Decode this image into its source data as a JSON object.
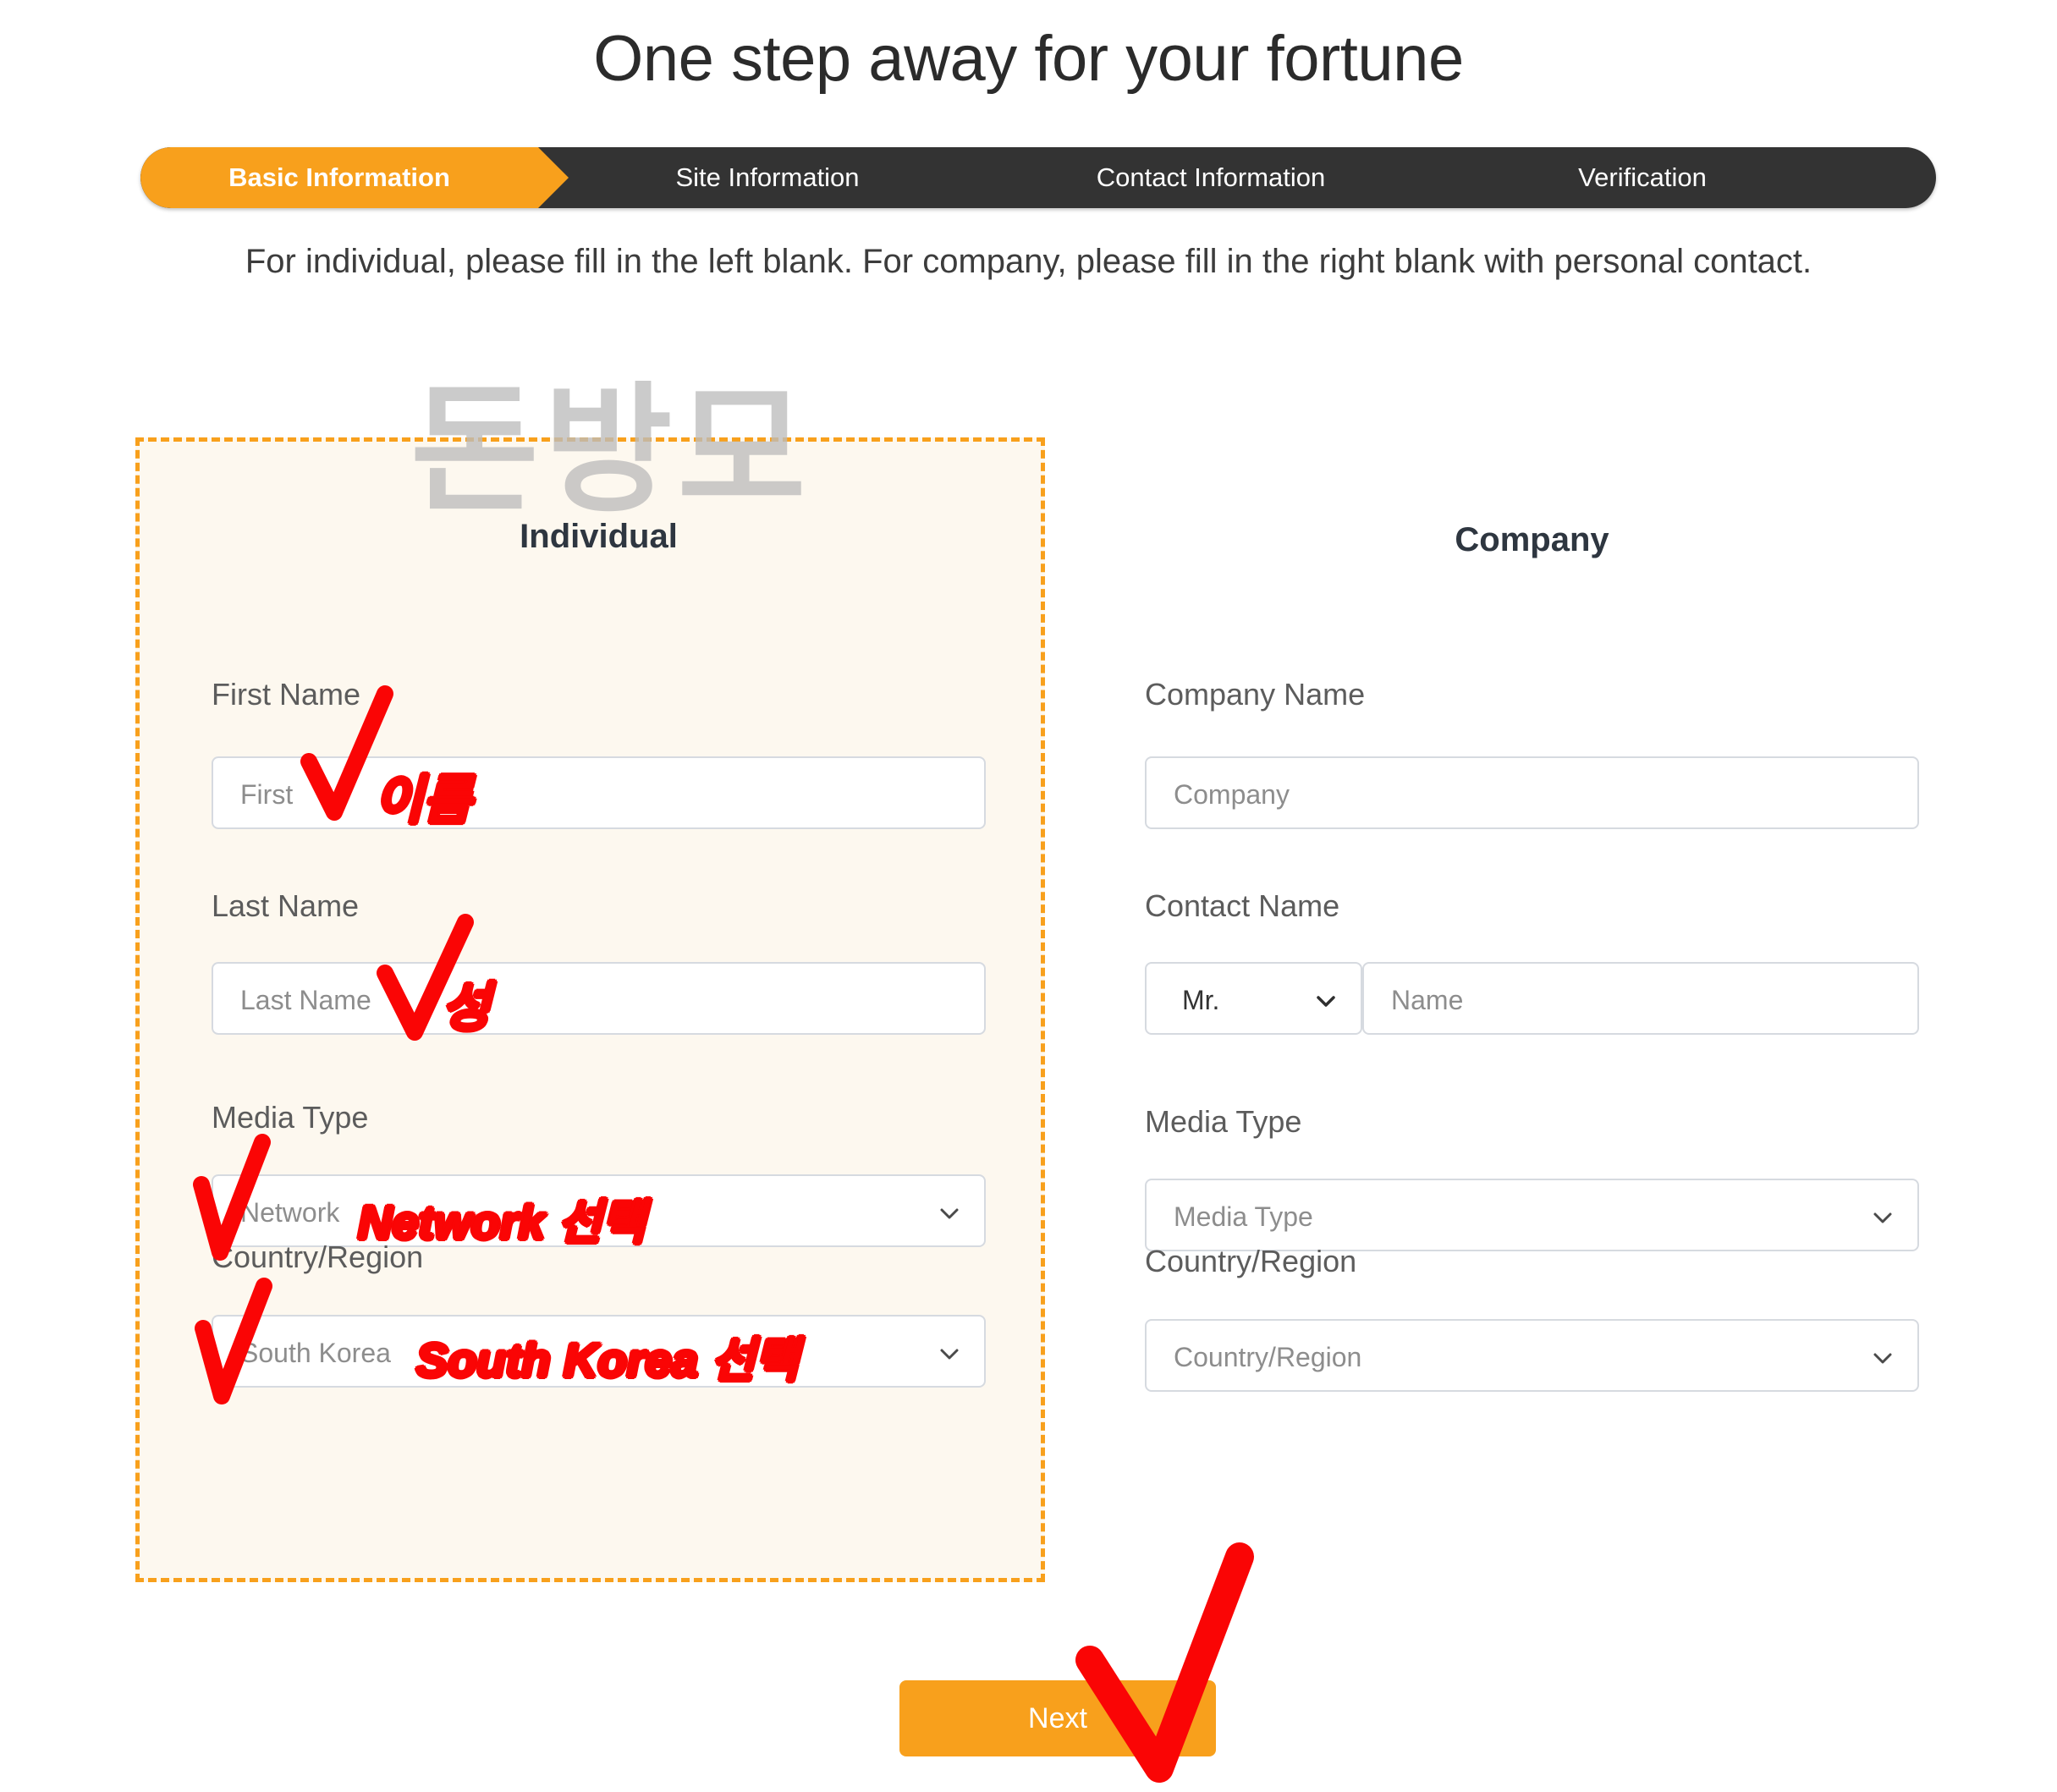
{
  "page": {
    "title": "One step away for your fortune",
    "intro": "For individual, please fill in the left blank. For company, please fill in the right blank with personal contact.",
    "watermark": "돈방모",
    "accent_color": "#f8a01c",
    "stepbar_color": "#333333",
    "highlight_bg": "#fdf8ef",
    "annotation_color": "#fa0505"
  },
  "stepbar": {
    "steps": [
      {
        "label": "Basic Information",
        "state": "active"
      },
      {
        "label": "Site Information",
        "state": "inactive"
      },
      {
        "label": "Contact Information",
        "state": "inactive"
      },
      {
        "label": "Verification",
        "state": "inactive"
      }
    ]
  },
  "individual": {
    "heading": "Individual",
    "fields": {
      "first_name": {
        "label": "First Name",
        "placeholder": "First",
        "value": ""
      },
      "last_name": {
        "label": "Last Name",
        "placeholder": "Last Name",
        "value": ""
      },
      "media_type": {
        "label": "Media Type",
        "selected": "Network"
      },
      "country": {
        "label": "Country/Region",
        "selected": "South Korea"
      }
    }
  },
  "company": {
    "heading": "Company",
    "fields": {
      "company_name": {
        "label": "Company Name",
        "placeholder": "Company",
        "value": ""
      },
      "contact_name": {
        "label": "Contact Name",
        "title_selected": "Mr.",
        "placeholder": "Name",
        "value": ""
      },
      "media_type": {
        "label": "Media Type",
        "selected": "Media Type"
      },
      "country": {
        "label": "Country/Region",
        "selected": "Country/Region"
      }
    }
  },
  "footer": {
    "next_label": "Next"
  },
  "annotations": [
    {
      "id": "first-name",
      "text": "이름"
    },
    {
      "id": "last-name",
      "text": "성"
    },
    {
      "id": "media-type",
      "text": "Network 선택"
    },
    {
      "id": "country",
      "text": "South Korea 선택"
    }
  ]
}
